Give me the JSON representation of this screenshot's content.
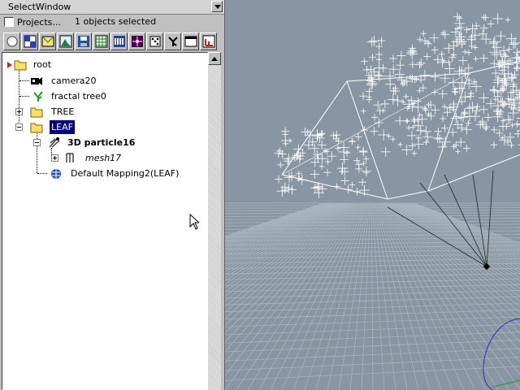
{
  "select_window": {
    "label": "SelectWindow"
  },
  "options": {
    "projects_label": "Projects...",
    "selection_count": "1 objects selected",
    "projects_checked": false
  },
  "toolbar": {
    "buttons": [
      {
        "icon": "sphere-icon"
      },
      {
        "icon": "checker-icon"
      },
      {
        "icon": "envelope-icon"
      },
      {
        "icon": "mountain-icon"
      },
      {
        "icon": "floppy-icon"
      },
      {
        "icon": "grid-icon"
      },
      {
        "icon": "comb-icon"
      },
      {
        "icon": "target-icon"
      },
      {
        "icon": "dice-icon"
      },
      {
        "icon": "branch-icon"
      },
      {
        "icon": "window-icon"
      },
      {
        "icon": "chart-icon"
      }
    ]
  },
  "tree": {
    "root": "root",
    "camera": "camera20",
    "fractal": "fractal tree0",
    "tree_folder": "TREE",
    "leaf_folder": "LEAF",
    "particle": "3D particle16",
    "mesh": "mesh17",
    "mapping": "Default Mapping2(LEAF)"
  },
  "colors": {
    "selection": "#000080",
    "viewport_bg": "#8796a2",
    "grid": "#a9b5bf"
  }
}
